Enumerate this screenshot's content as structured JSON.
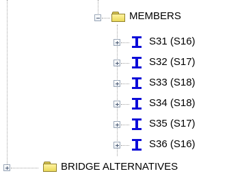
{
  "tree": {
    "members_folder": {
      "label": "MEMBERS",
      "expanded": true,
      "icon": "folder-icon"
    },
    "members": [
      {
        "label": "S31 (S16)",
        "icon": "i-beam-icon",
        "expanded": false
      },
      {
        "label": "S32 (S17)",
        "icon": "i-beam-icon",
        "expanded": false
      },
      {
        "label": "S33 (S18)",
        "icon": "i-beam-icon",
        "expanded": false
      },
      {
        "label": "S34 (S18)",
        "icon": "i-beam-icon",
        "expanded": false
      },
      {
        "label": "S35 (S17)",
        "icon": "i-beam-icon",
        "expanded": false
      },
      {
        "label": "S36 (S16)",
        "icon": "i-beam-icon",
        "expanded": false
      }
    ],
    "bridge_alternatives_folder": {
      "label": "BRIDGE ALTERNATIVES",
      "expanded": false,
      "icon": "folder-icon"
    }
  },
  "colors": {
    "tree_line": "#a0a0a0",
    "beam_icon": "#0c0cd8",
    "folder_fill": "#ead95a"
  }
}
